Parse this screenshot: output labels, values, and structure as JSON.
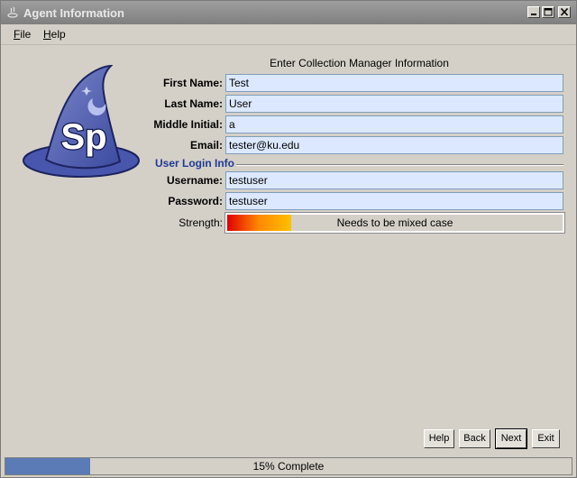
{
  "window": {
    "title": "Agent Information"
  },
  "menubar": {
    "items": [
      {
        "label": "File",
        "mnemonic": "F",
        "rest": "ile"
      },
      {
        "label": "Help",
        "mnemonic": "H",
        "rest": "elp"
      }
    ]
  },
  "logo": {
    "text": "Sp"
  },
  "form": {
    "heading": "Enter Collection Manager Information",
    "first_name": {
      "label": "First Name:",
      "value": "Test"
    },
    "last_name": {
      "label": "Last Name:",
      "value": "User"
    },
    "middle_initial": {
      "label": "Middle Initial:",
      "value": "a"
    },
    "email": {
      "label": "Email:",
      "value": "tester@ku.edu"
    },
    "login_section": "User Login Info",
    "username": {
      "label": "Username:",
      "value": "testuser"
    },
    "password": {
      "label": "Password:",
      "value": "testuser"
    },
    "strength": {
      "label": "Strength:",
      "message": "Needs to be mixed case",
      "level_fraction": 0.19
    }
  },
  "buttons": {
    "help": "Help",
    "back": "Back",
    "next": "Next",
    "exit": "Exit"
  },
  "progress": {
    "text": "15% Complete",
    "percent": 15
  },
  "colors": {
    "field_bg": "#dce8ff",
    "section_text": "#1f3a93",
    "progress_fill": "#5a7bb5"
  },
  "icons": [
    "specify-wizard-hat-logo",
    "java-app-icon",
    "minimize-icon",
    "maximize-icon",
    "close-icon"
  ]
}
